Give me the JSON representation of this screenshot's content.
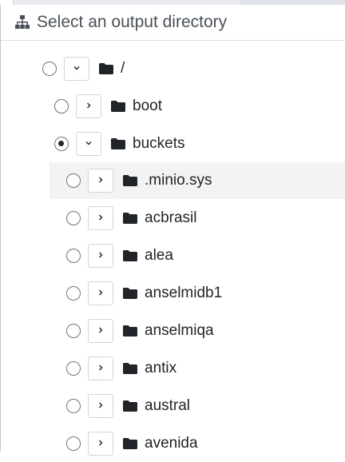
{
  "dialog": {
    "title": "Select an output directory",
    "icon": "sitemap-icon"
  },
  "tree": [
    {
      "label": "/",
      "depth": 0,
      "expanded": true,
      "selected": false,
      "highlighted": false
    },
    {
      "label": "boot",
      "depth": 1,
      "expanded": false,
      "selected": false,
      "highlighted": false
    },
    {
      "label": "buckets",
      "depth": 1,
      "expanded": true,
      "selected": true,
      "highlighted": false
    },
    {
      "label": ".minio.sys",
      "depth": 2,
      "expanded": false,
      "selected": false,
      "highlighted": true
    },
    {
      "label": "acbrasil",
      "depth": 2,
      "expanded": false,
      "selected": false,
      "highlighted": false
    },
    {
      "label": "alea",
      "depth": 2,
      "expanded": false,
      "selected": false,
      "highlighted": false
    },
    {
      "label": "anselmidb1",
      "depth": 2,
      "expanded": false,
      "selected": false,
      "highlighted": false
    },
    {
      "label": "anselmiqa",
      "depth": 2,
      "expanded": false,
      "selected": false,
      "highlighted": false
    },
    {
      "label": "antix",
      "depth": 2,
      "expanded": false,
      "selected": false,
      "highlighted": false
    },
    {
      "label": "austral",
      "depth": 2,
      "expanded": false,
      "selected": false,
      "highlighted": false
    },
    {
      "label": "avenida",
      "depth": 2,
      "expanded": false,
      "selected": false,
      "highlighted": false
    }
  ],
  "icons": {
    "folder": "folder-icon",
    "expanded": "chevron-down-icon",
    "collapsed": "chevron-right-icon"
  }
}
